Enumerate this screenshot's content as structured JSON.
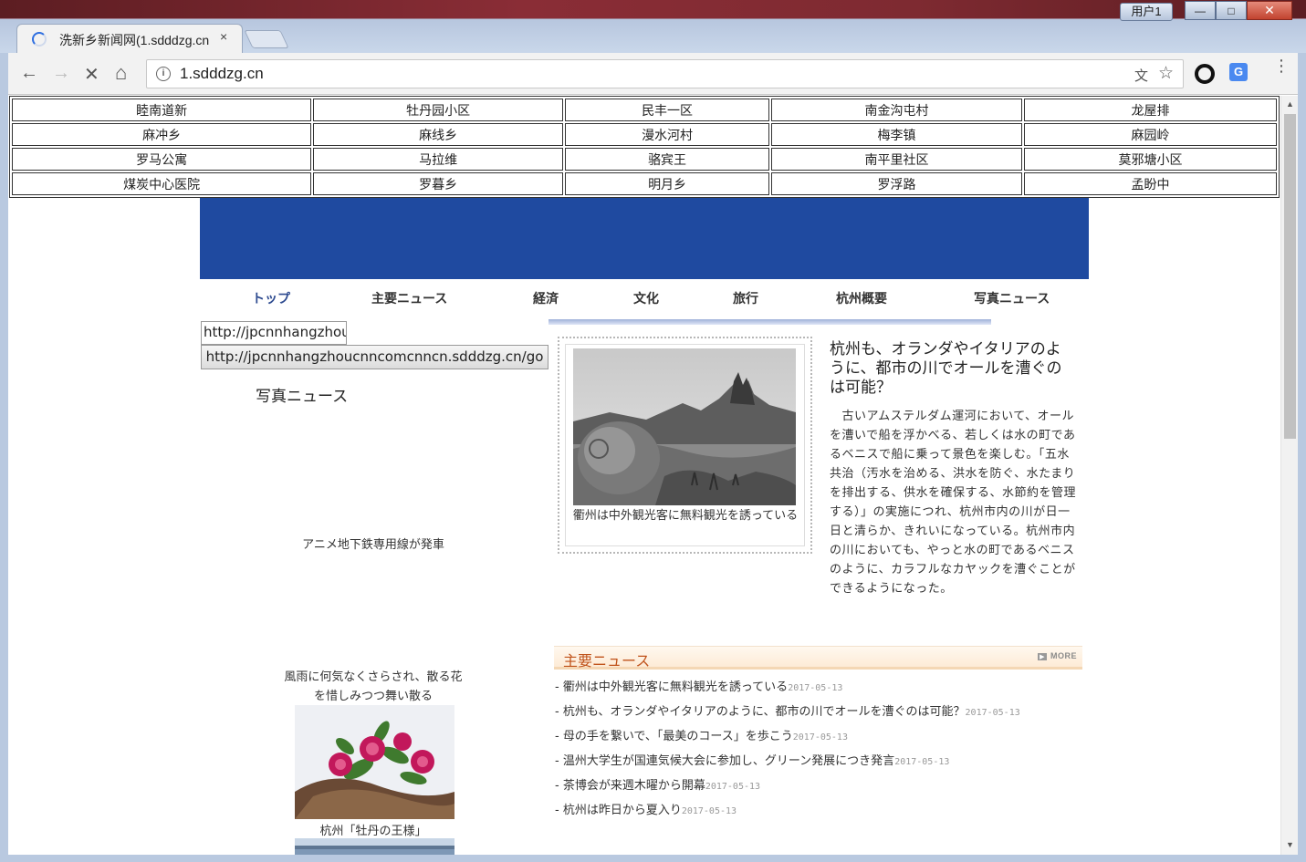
{
  "browser": {
    "tab_title": "洗新乡新闻网(1.sdddzg.cn",
    "tab_close": "×",
    "user_button": "用户1",
    "url": "1.sdddzg.cn",
    "omnibox_info": "i",
    "minimize": "—",
    "maximize": "□",
    "close": "✕",
    "back": "←",
    "forward": "→",
    "stop": "✕",
    "home": "⌂",
    "translate": "文",
    "star": "☆",
    "ext_letter": "G",
    "menu": "⋮",
    "scroll_up": "▲",
    "scroll_down": "▼"
  },
  "link_table": [
    [
      "睦南道新",
      "牡丹园小区",
      "民丰一区",
      "南金沟屯村",
      "龙屋排"
    ],
    [
      "麻冲乡",
      "麻线乡",
      "漫水河村",
      "梅李镇",
      "麻园岭"
    ],
    [
      "罗马公寓",
      "马拉维",
      "骆宾王",
      "南平里社区",
      "莫邪塘小区"
    ],
    [
      "煤炭中心医院",
      "罗暮乡",
      "明月乡",
      "罗浮路",
      "孟盼中"
    ]
  ],
  "main_nav": [
    "トップ",
    "主要ニュース",
    "経済",
    "文化",
    "旅行",
    "杭州概要",
    "写真ニュース"
  ],
  "url_input_value": "http://jpcnnhangzhoucnncomcnncn.sdddzg.cn/go",
  "go_button": "http://jpcnnhangzhoucnncomcnncn.sdddzg.cn/go",
  "photo_news": {
    "title": "写真ニュース",
    "caption1": "アニメ地下鉄専用線が発車",
    "caption2": "風雨に何気なくさらされ、散る花を惜しみつつ舞い散る",
    "caption3": "杭州「牡丹の王様」"
  },
  "featured": {
    "photo_caption": "衢州は中外観光客に無料観光を誘っている",
    "article_title": "杭州も、オランダやイタリアのように、都市の川でオールを漕ぐのは可能？",
    "article_body": "　古いアムステルダム運河において、オールを漕いで船を浮かべる、若しくは水の町であるベニスで船に乗って景色を楽しむ。「五水共治（汚水を治める、洪水を防ぐ、水たまりを排出する、供水を確保する、水節約を管理する）」の実施につれ、杭州市内の川が日一日と清らか、きれいになっている。杭州市内の川においても、やっと水の町であるベニスのように、カラフルなカヤックを漕ぐことができるようになった。"
  },
  "news": {
    "title": "主要ニュース",
    "more": "MORE",
    "items": [
      {
        "text": "- 衢州は中外観光客に無料観光を誘っている",
        "date": "2017-05-13"
      },
      {
        "text": "- 杭州も、オランダやイタリアのように、都市の川でオールを漕ぐのは可能？",
        "date": "2017-05-13"
      },
      {
        "text": "- 母の手を繋いで、「最美のコース」を歩こう",
        "date": "2017-05-13"
      },
      {
        "text": "- 温州大学生が国連気候大会に参加し、グリーン発展につき発言",
        "date": "2017-05-13"
      },
      {
        "text": "- 茶博会が来週木曜から開幕",
        "date": "2017-05-13"
      },
      {
        "text": "- 杭州は昨日から夏入り",
        "date": "2017-05-13"
      }
    ]
  }
}
